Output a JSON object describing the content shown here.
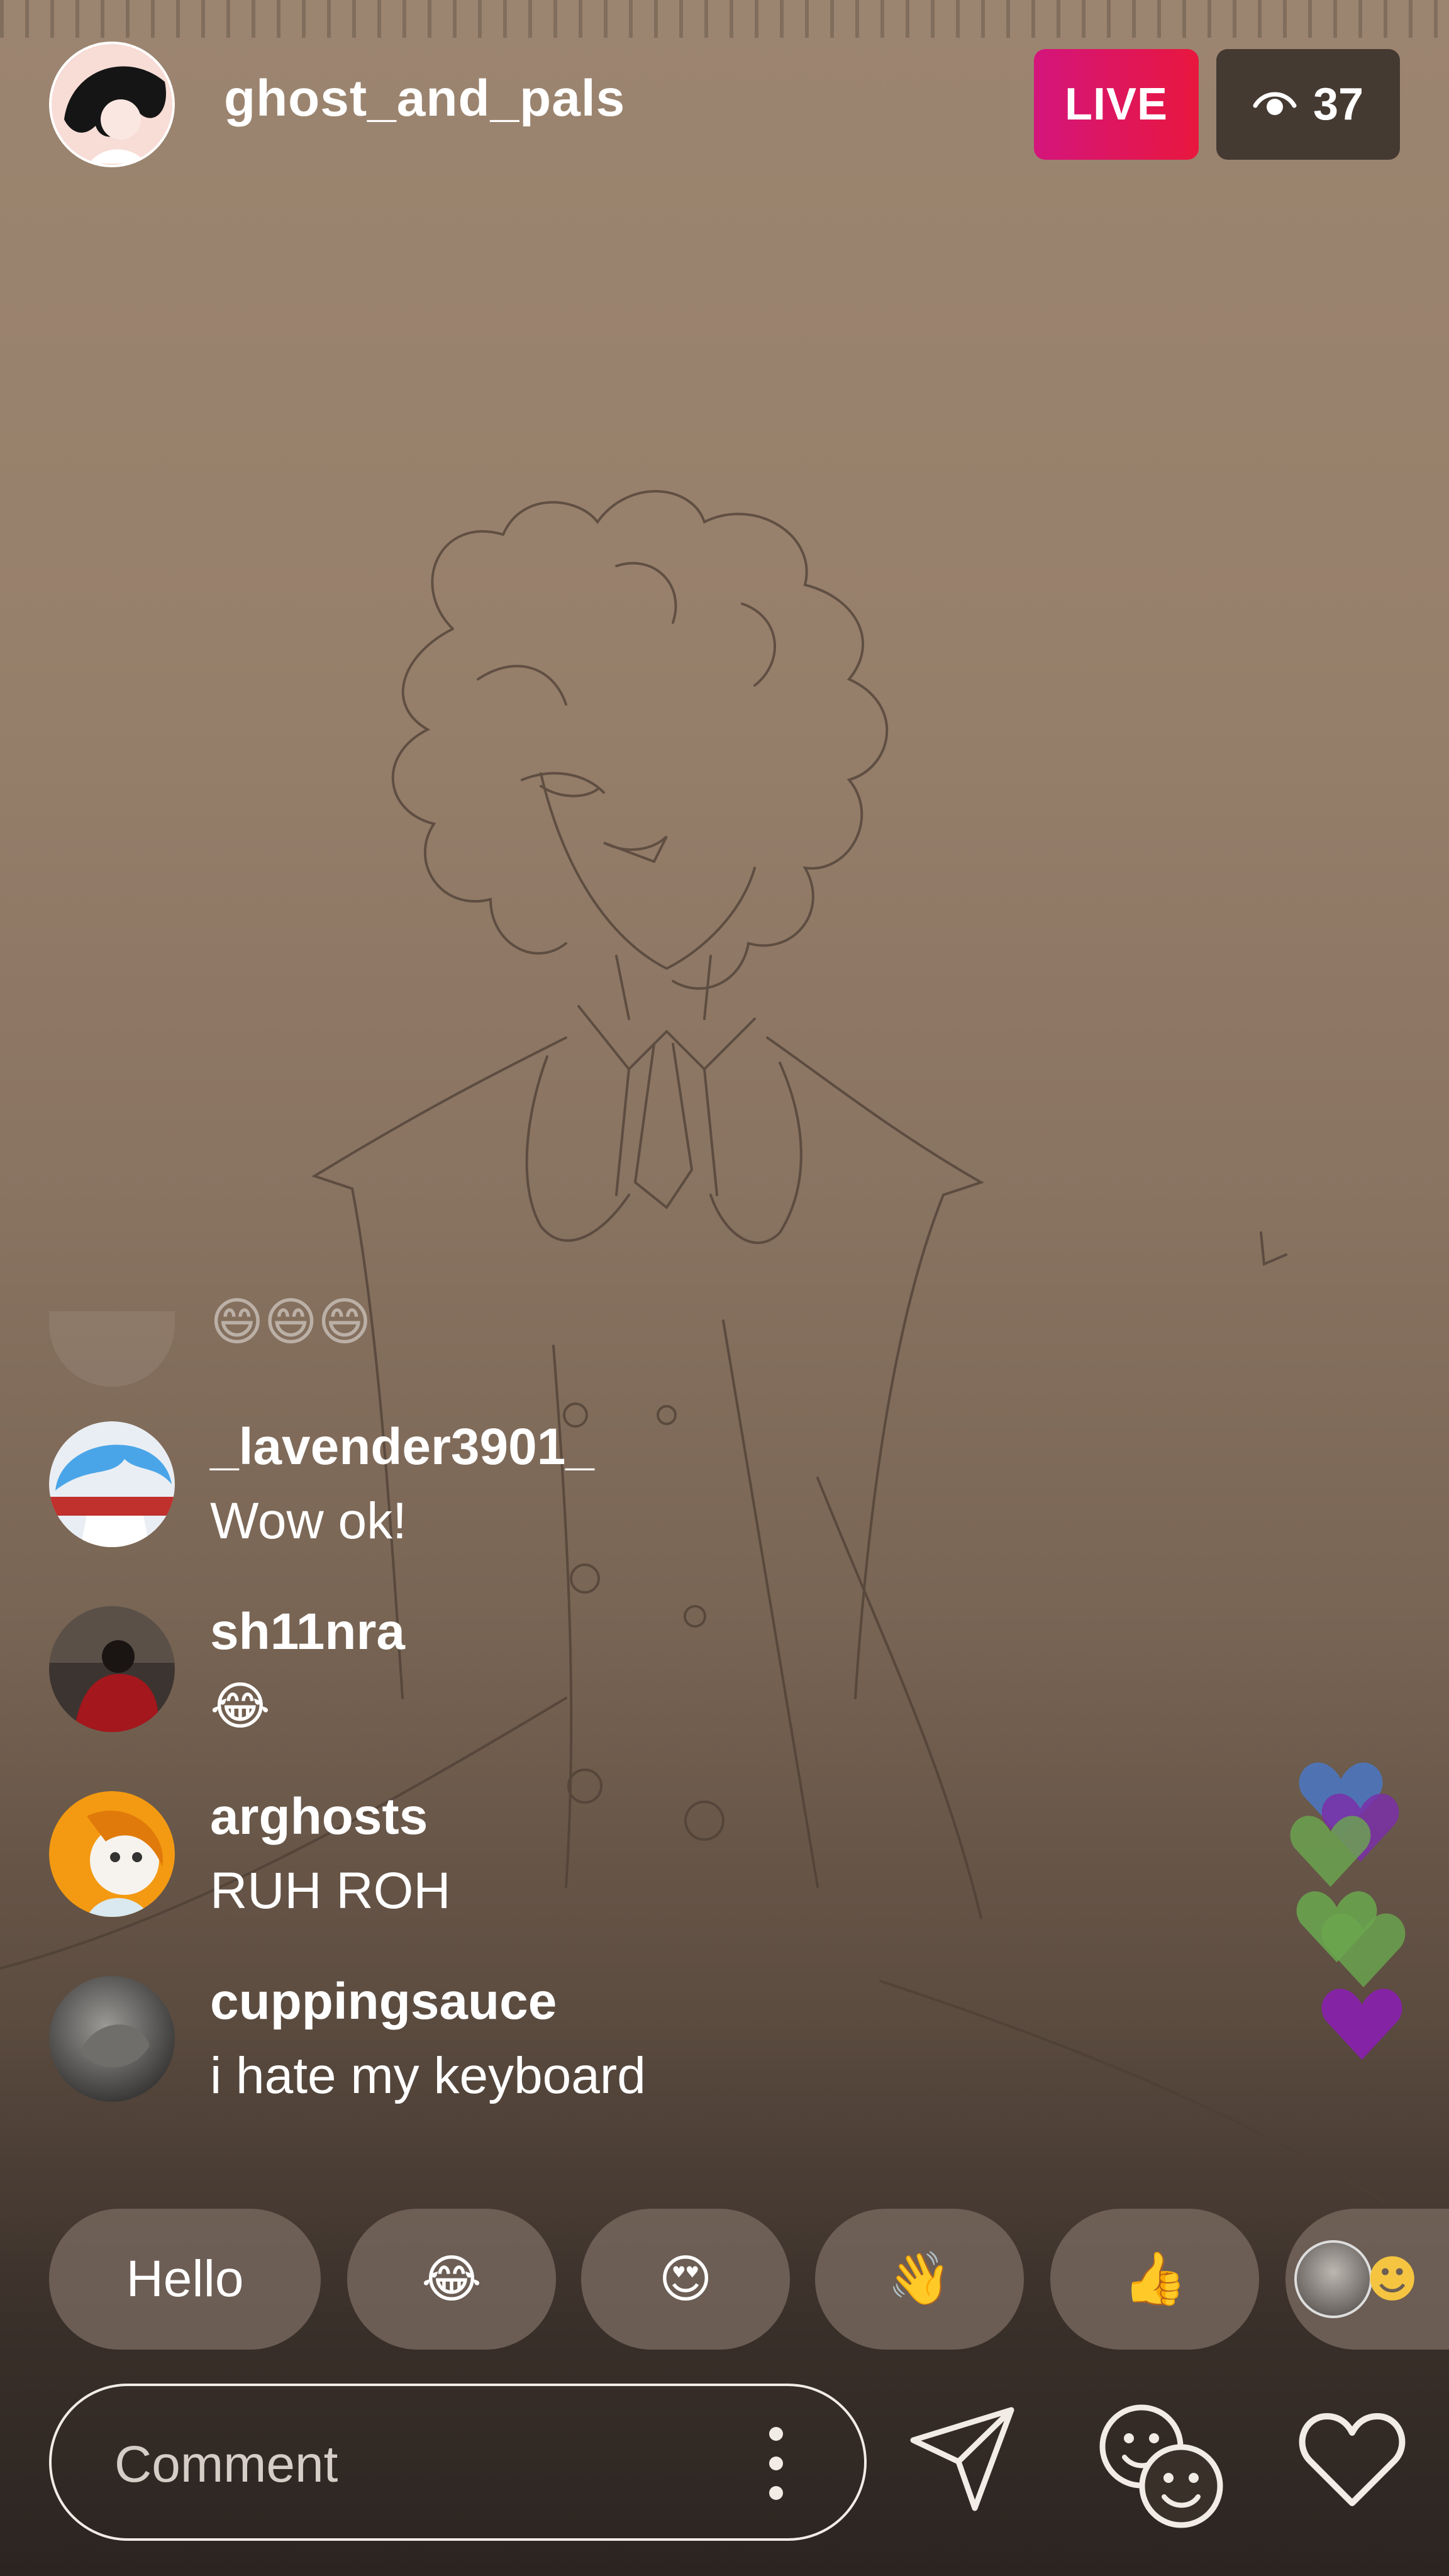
{
  "stream": {
    "host_username": "ghost_and_pals",
    "live_label": "LIVE",
    "viewer_count": "37",
    "viewer_icon": "eye-icon"
  },
  "comments": [
    {
      "username": "",
      "text": "😄😄😄",
      "avatar": "faded-avatar"
    },
    {
      "username": "_lavender3901_",
      "text": "Wow ok!",
      "avatar": "blue-hair-avatar"
    },
    {
      "username": "sh11nra",
      "text": "😂",
      "avatar": "red-figure-avatar"
    },
    {
      "username": "arghosts",
      "text": "RUH ROH",
      "avatar": "orange-hair-avatar"
    },
    {
      "username": "cuppingsauce",
      "text": "i hate my keyboard",
      "avatar": "grey-avatar"
    }
  ],
  "quick_replies": [
    "Hello",
    "😂",
    "😍",
    "👋",
    "👍"
  ],
  "composer": {
    "placeholder": "Comment",
    "more_icon": "vertical-dots-icon",
    "send_icon": "paper-plane-icon",
    "effects_icon": "faces-icon",
    "like_icon": "heart-outline-icon"
  },
  "floating_hearts": {
    "colors": [
      "#4a78c4",
      "#7a2fa8",
      "#6aa84f",
      "#6aa84f",
      "#6aa84f",
      "#8a1fb0"
    ]
  }
}
